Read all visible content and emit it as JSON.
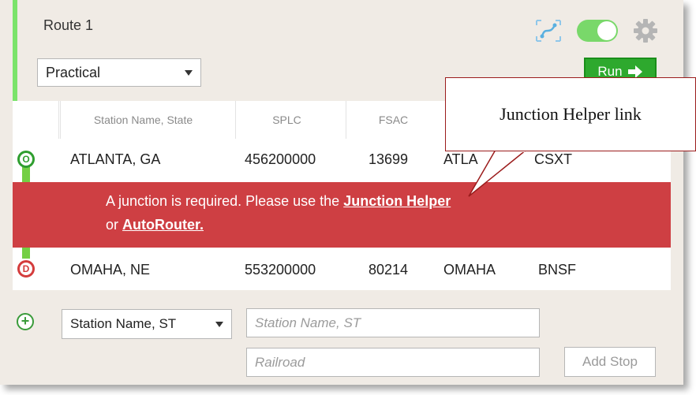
{
  "route": {
    "title": "Route 1"
  },
  "route_type": {
    "selected": "Practical"
  },
  "header": {
    "toggle_on": true,
    "toggle_color": "#79d86a"
  },
  "run_button": {
    "label": "Run",
    "icon": "arrow-right-icon"
  },
  "table": {
    "columns": [
      "Station Name, State",
      "SPLC",
      "FSAC",
      "",
      ""
    ],
    "rows": [
      {
        "marker": "O",
        "station": "ATLANTA, GA",
        "splc": "456200000",
        "fsac": "13699",
        "city": "ATLA",
        "railroad": "CSXT"
      },
      {
        "marker": "D",
        "station": "OMAHA, NE",
        "splc": "553200000",
        "fsac": "80214",
        "city": "OMAHA",
        "railroad": "BNSF"
      }
    ]
  },
  "junction_alert": {
    "text_before": "A junction is required. Please use the ",
    "junction_link": "Junction Helper",
    "text_or": "or ",
    "autorouter_link": "AutoRouter.",
    "color": "#ce3f43"
  },
  "add_stop": {
    "search_type": "Station Name, ST",
    "station_placeholder": "Station Name, ST",
    "railroad_placeholder": "Railroad",
    "button_label": "Add Stop"
  },
  "callout": {
    "text": "Junction Helper link"
  },
  "colors": {
    "accent": "#7be36b",
    "run": "#2ea92e",
    "panel": "#f0ebe5"
  }
}
